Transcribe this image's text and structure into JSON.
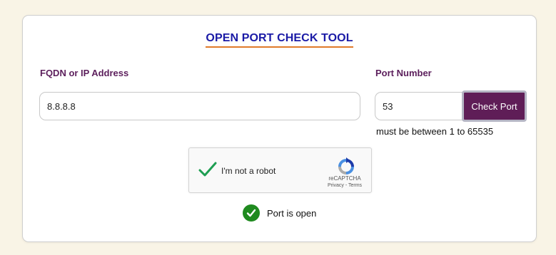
{
  "tool": {
    "title": "OPEN PORT CHECK TOOL"
  },
  "form": {
    "ip_label": "FQDN or IP Address",
    "ip_value": "8.8.8.8",
    "port_label": "Port Number",
    "port_value": "53",
    "check_button_label": "Check Port",
    "port_hint": "must be between 1 to 65535"
  },
  "captcha": {
    "label": "I'm not a robot",
    "checked": true,
    "brand": "reCAPTCHA",
    "links": "Privacy - Terms",
    "check_icon": "checkmark-icon",
    "logo_icon": "recaptcha-logo-icon"
  },
  "result": {
    "status_icon": "check-circle-icon",
    "status_text": "Port is open"
  },
  "colors": {
    "background": "#f9f4e6",
    "title": "#1a1aa6",
    "title_underline": "#e07a2a",
    "label": "#5c1f5c",
    "button": "#5f1d57",
    "success": "#1f8a1f",
    "captcha_check": "#1e9e52"
  }
}
